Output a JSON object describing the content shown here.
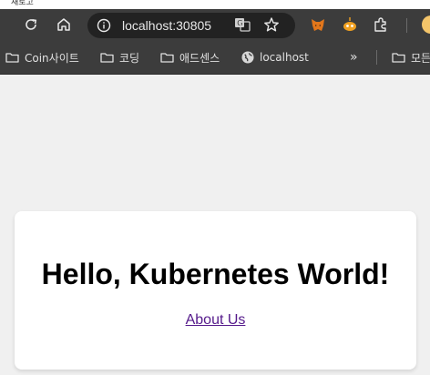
{
  "top_strip": {
    "label": "새로고"
  },
  "browser": {
    "url": "localhost:30805",
    "icons": {
      "reload": "reload-icon",
      "home": "home-icon",
      "site_info": "info-icon",
      "translate": "translate-icon",
      "bookmark": "star-icon",
      "metamask": "fox-extension-icon",
      "extension2": "bot-extension-icon",
      "extensions": "puzzle-icon",
      "profile": "profile-avatar"
    }
  },
  "bookmarks": {
    "items": [
      {
        "label": "Coin사이트",
        "icon": "folder-icon"
      },
      {
        "label": "코딩",
        "icon": "folder-icon"
      },
      {
        "label": "애드센스",
        "icon": "folder-icon"
      },
      {
        "label": "localhost",
        "icon": "globe-icon"
      }
    ],
    "overflow": "»",
    "all_label": "모든"
  },
  "page": {
    "heading": "Hello, Kubernetes World!",
    "link": "About Us"
  },
  "colors": {
    "toolbar_bg": "#3c3c3c",
    "omnibox_bg": "#222222",
    "page_bg": "#f0f0f0",
    "card_bg": "#ffffff",
    "visited_link": "#551a8b"
  }
}
